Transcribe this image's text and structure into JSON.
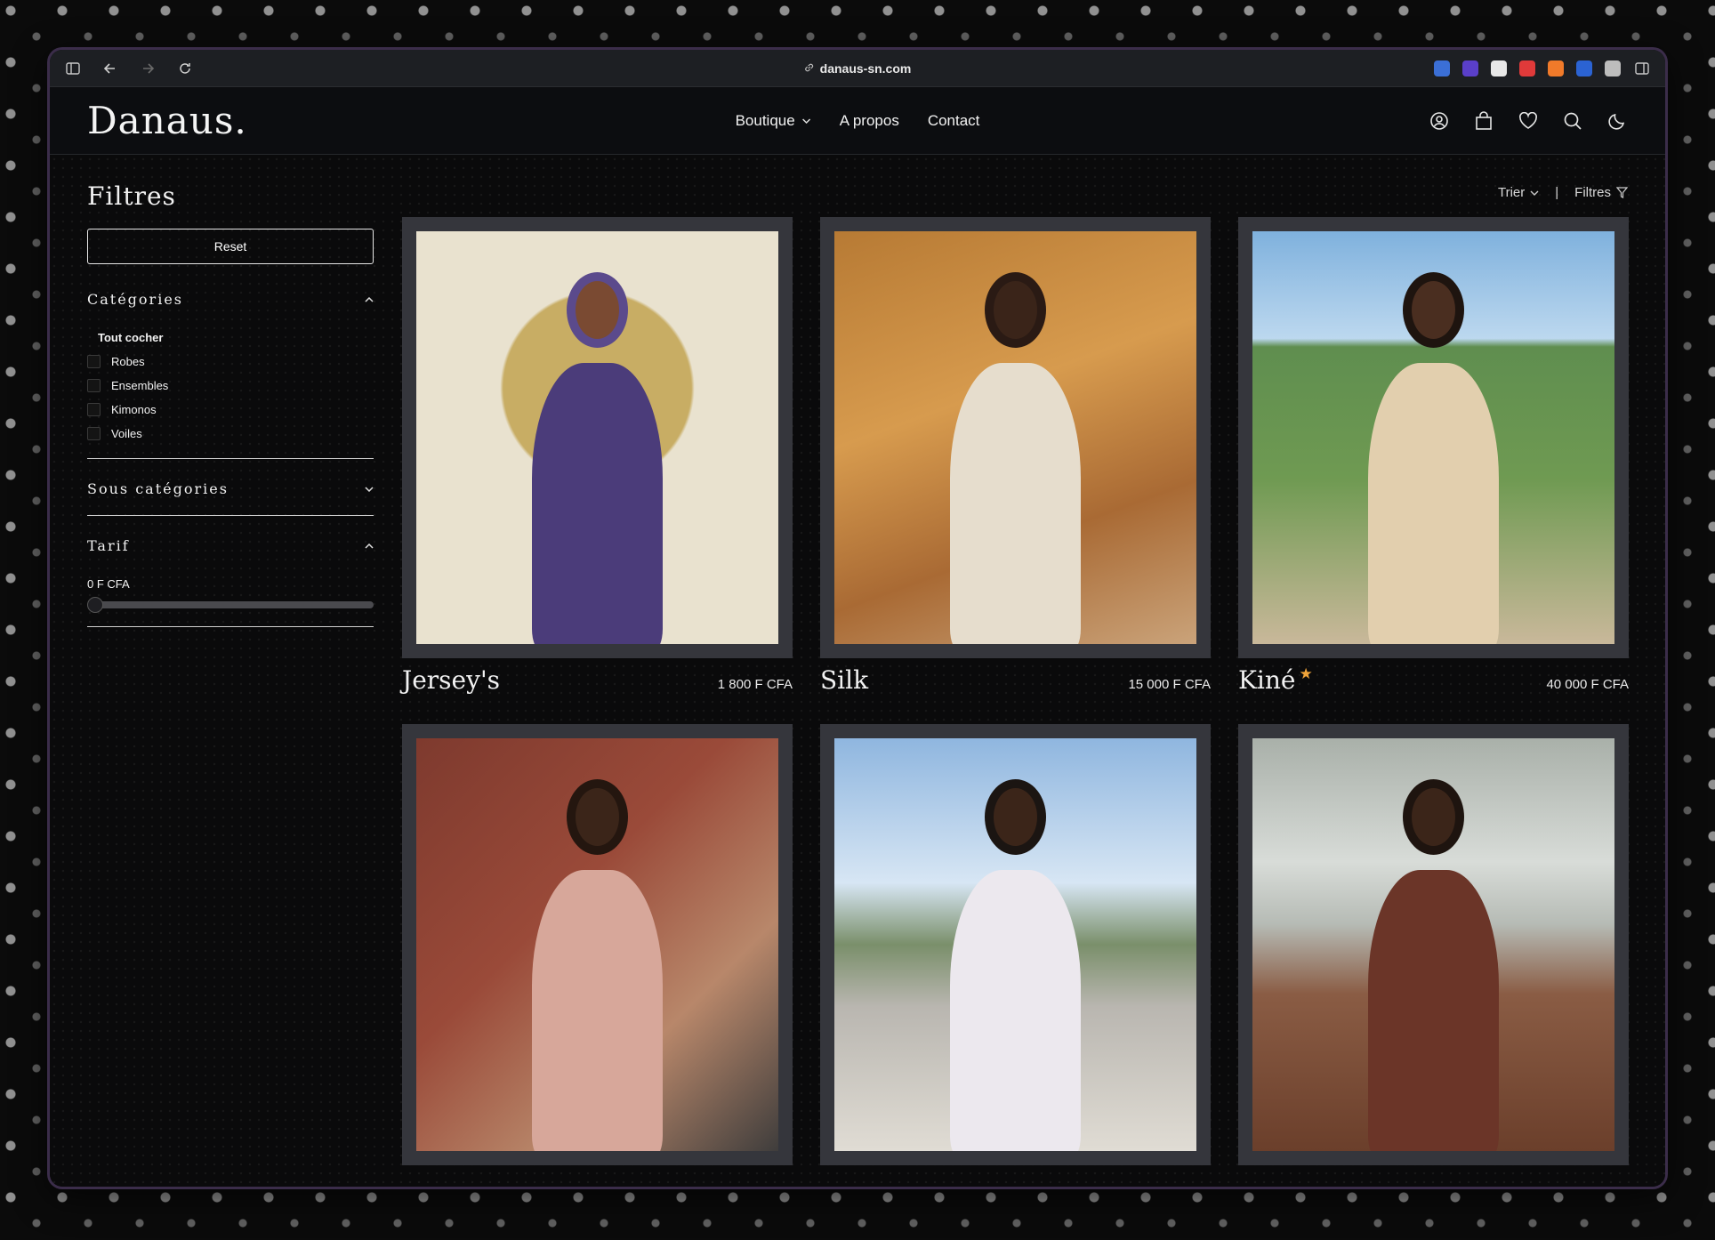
{
  "browser": {
    "url": "danaus-sn.com",
    "extensions": [
      "#3b6fd6",
      "#5a3fc9",
      "#e8e8e8",
      "#e03a3a",
      "#f07a2a",
      "#2b63d3",
      "#bdbdbd"
    ]
  },
  "header": {
    "logo": "Danaus.",
    "nav": [
      {
        "label": "Boutique",
        "dropdown": true
      },
      {
        "label": "A propos"
      },
      {
        "label": "Contact"
      }
    ],
    "icons": [
      "user-icon",
      "bag-icon",
      "heart-icon",
      "search-icon",
      "moon-icon"
    ]
  },
  "sidebar": {
    "title": "Filtres",
    "reset_label": "Reset",
    "categories": {
      "title": "Catégories",
      "check_all": "Tout cocher",
      "items": [
        "Robes",
        "Ensembles",
        "Kimonos",
        "Voiles"
      ]
    },
    "subcategories": {
      "title": "Sous catégories"
    },
    "price": {
      "title": "Tarif",
      "value": "0 F CFA",
      "level": 0.0
    }
  },
  "sort_bar": {
    "sort_label": "Trier",
    "filters_label": "Filtres",
    "separator": "|"
  },
  "products": [
    {
      "name": "Jersey's",
      "price": "1 800 F CFA",
      "featured": false,
      "art": "p1"
    },
    {
      "name": "Silk",
      "price": "15 000 F CFA",
      "featured": false,
      "art": "p2"
    },
    {
      "name": "Kiné",
      "price": "40 000 F CFA",
      "featured": true,
      "art": "p3"
    },
    {
      "name": "",
      "price": "",
      "featured": false,
      "art": "p4"
    },
    {
      "name": "",
      "price": "",
      "featured": false,
      "art": "p5"
    },
    {
      "name": "",
      "price": "",
      "featured": false,
      "art": "p6"
    }
  ]
}
